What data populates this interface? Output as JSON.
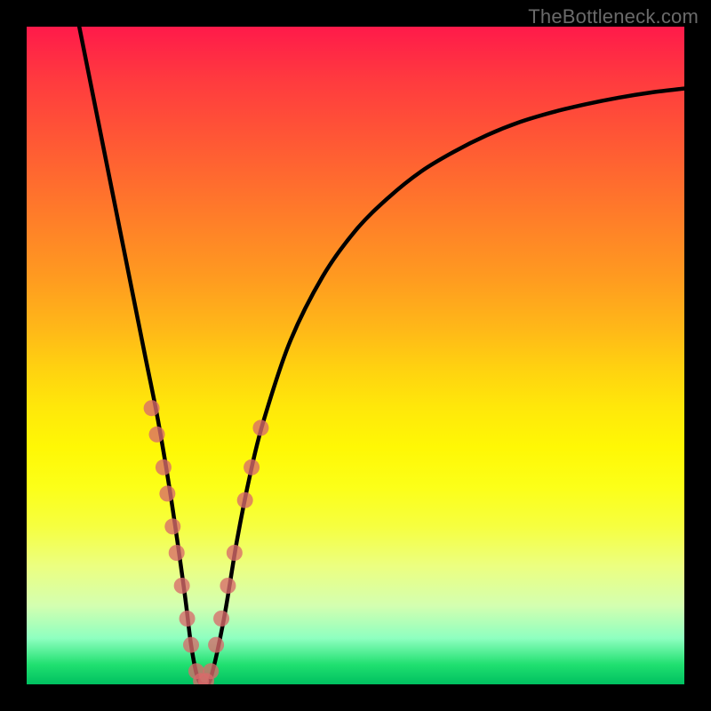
{
  "watermark": "TheBottleneck.com",
  "chart_data": {
    "type": "line",
    "title": "",
    "xlabel": "",
    "ylabel": "",
    "xlim": [
      0,
      100
    ],
    "ylim": [
      0,
      100
    ],
    "annotations": [],
    "background_gradient": {
      "stops": [
        {
          "pos": 0,
          "color": "#ff1a4a"
        },
        {
          "pos": 50,
          "color": "#ffd210"
        },
        {
          "pos": 100,
          "color": "#00c060"
        }
      ]
    },
    "series": [
      {
        "name": "bottleneck-curve",
        "color": "#000000",
        "x": [
          8,
          10,
          12,
          14,
          16,
          18,
          20,
          22,
          24,
          25,
          26,
          27,
          28,
          30,
          32,
          34,
          36,
          40,
          45,
          50,
          55,
          60,
          65,
          70,
          75,
          80,
          85,
          90,
          95,
          100
        ],
        "y": [
          100,
          90,
          80,
          70,
          60,
          50,
          40,
          28,
          14,
          6,
          1,
          0,
          1,
          10,
          22,
          32,
          40,
          52,
          62,
          69,
          74,
          78,
          81,
          83.5,
          85.5,
          87,
          88.2,
          89.2,
          90,
          90.6
        ]
      }
    ],
    "markers": [
      {
        "name": "dots-left-branch",
        "color": "#d86a6a",
        "radius": 9,
        "points": [
          {
            "x": 19.0,
            "y": 42
          },
          {
            "x": 19.8,
            "y": 38
          },
          {
            "x": 20.8,
            "y": 33
          },
          {
            "x": 21.4,
            "y": 29
          },
          {
            "x": 22.2,
            "y": 24
          },
          {
            "x": 22.8,
            "y": 20
          },
          {
            "x": 23.6,
            "y": 15
          },
          {
            "x": 24.4,
            "y": 10
          },
          {
            "x": 25.0,
            "y": 6
          }
        ]
      },
      {
        "name": "dots-bottom",
        "color": "#d86a6a",
        "radius": 9,
        "points": [
          {
            "x": 25.8,
            "y": 2
          },
          {
            "x": 26.5,
            "y": 0.5
          },
          {
            "x": 27.3,
            "y": 0.5
          },
          {
            "x": 28.0,
            "y": 2
          }
        ]
      },
      {
        "name": "dots-right-branch",
        "color": "#d86a6a",
        "radius": 9,
        "points": [
          {
            "x": 28.8,
            "y": 6
          },
          {
            "x": 29.6,
            "y": 10
          },
          {
            "x": 30.6,
            "y": 15
          },
          {
            "x": 31.6,
            "y": 20
          },
          {
            "x": 33.2,
            "y": 28
          },
          {
            "x": 34.2,
            "y": 33
          },
          {
            "x": 35.6,
            "y": 39
          }
        ]
      }
    ]
  }
}
